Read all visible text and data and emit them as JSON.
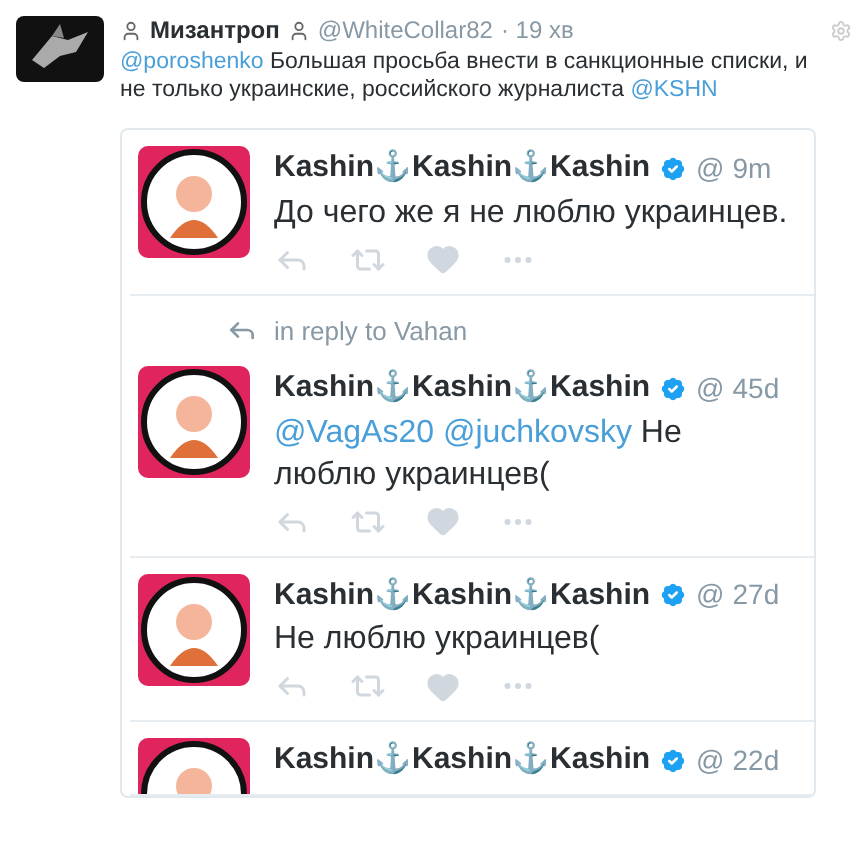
{
  "tweet": {
    "name": "Мизантроп",
    "handle": "@WhiteCollar82",
    "time": "· 19 хв",
    "text": [
      {
        "kind": "mention",
        "text": "@poroshenko"
      },
      {
        "kind": "text",
        "text": "Большая просьба внести в санкционные списки, и не только украинские, российского журналиста"
      },
      {
        "kind": "mention",
        "text": "@KSHN"
      }
    ]
  },
  "quoted": [
    {
      "name": "Kashin⚓Kashin⚓Kashin",
      "verified": true,
      "handle": "@",
      "time": "9m",
      "text": [
        {
          "kind": "text",
          "text": "До чего же я не люблю украинцев."
        }
      ]
    },
    {
      "reply_to": "in reply to Vahan",
      "name": "Kashin⚓Kashin⚓Kashin",
      "verified": true,
      "handle": "@",
      "time": "45d",
      "text": [
        {
          "kind": "mention",
          "text": "@VagAs20"
        },
        {
          "kind": "mention",
          "text": "@juchkovsky"
        },
        {
          "kind": "text",
          "text": "Не люблю украинцев("
        }
      ]
    },
    {
      "name": "Kashin⚓Kashin⚓Kashin",
      "verified": true,
      "handle": "@",
      "time": "27d",
      "text": [
        {
          "kind": "text",
          "text": "Не люблю украинцев("
        }
      ]
    },
    {
      "name": "Kashin⚓Kashin⚓Kashin",
      "verified": true,
      "handle": "@",
      "time": "22d"
    }
  ]
}
